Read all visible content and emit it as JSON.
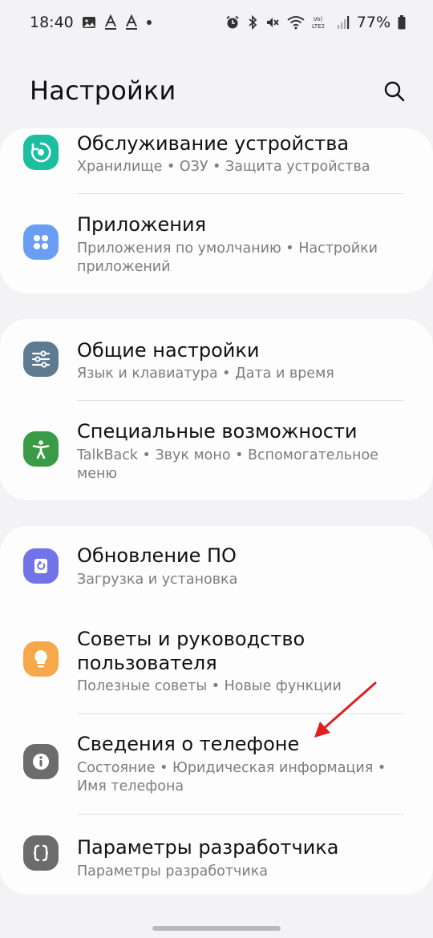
{
  "status_bar": {
    "time": "18:40",
    "battery": "77%"
  },
  "header": {
    "title": "Настройки"
  },
  "items": [
    {
      "title": "Обслуживание устройства",
      "subtitle": "Хранилище  •  ОЗУ  •  Защита устройства",
      "icon": "device-care-icon",
      "color": "#1bbfa0"
    },
    {
      "title": "Приложения",
      "subtitle": "Приложения по умолчанию  •  Настройки приложений",
      "icon": "apps-icon",
      "color": "#6a9ef4"
    },
    {
      "title": "Общие настройки",
      "subtitle": "Язык и клавиатура  •  Дата и время",
      "icon": "sliders-icon",
      "color": "#5e7a91"
    },
    {
      "title": "Специальные возможности",
      "subtitle": "TalkBack  •  Звук моно  •  Вспомогательное меню",
      "icon": "accessibility-icon",
      "color": "#3a9b47"
    },
    {
      "title": "Обновление ПО",
      "subtitle": "Загрузка и установка",
      "icon": "software-update-icon",
      "color": "#7273e8"
    },
    {
      "title": "Советы и руководство пользователя",
      "subtitle": "Полезные советы  •  Новые функции",
      "icon": "lightbulb-icon",
      "color": "#f5a94a"
    },
    {
      "title": "Сведения о телефоне",
      "subtitle": "Состояние  •  Юридическая информация  •  Имя телефона",
      "icon": "info-icon",
      "color": "#6c6c6c"
    },
    {
      "title": "Параметры разработчика",
      "subtitle": "Параметры разработчика",
      "icon": "developer-options-icon",
      "color": "#6c6c6c"
    }
  ],
  "annotation": {
    "arrow_color": "#e02020"
  }
}
